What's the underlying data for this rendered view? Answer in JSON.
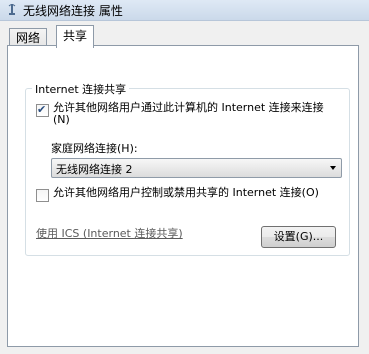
{
  "window": {
    "title": "无线网络连接 属性",
    "icon": "network-adapter-icon"
  },
  "tabs": [
    {
      "label": "网络",
      "active": false
    },
    {
      "label": "共享",
      "active": true
    }
  ],
  "sharing": {
    "group_title": "Internet 连接共享",
    "allow_connect": {
      "label": "允许其他网络用户通过此计算机的 Internet 连接来连接(N)",
      "checked": true
    },
    "home_network_label": "家庭网络连接(H):",
    "home_network_select": {
      "value": "无线网络连接 2"
    },
    "allow_control": {
      "label": "允许其他网络用户控制或禁用共享的 Internet 连接(O)",
      "checked": false
    },
    "ics_link": "使用 ICS (Internet 连接共享)",
    "settings_button": "设置(G)..."
  }
}
